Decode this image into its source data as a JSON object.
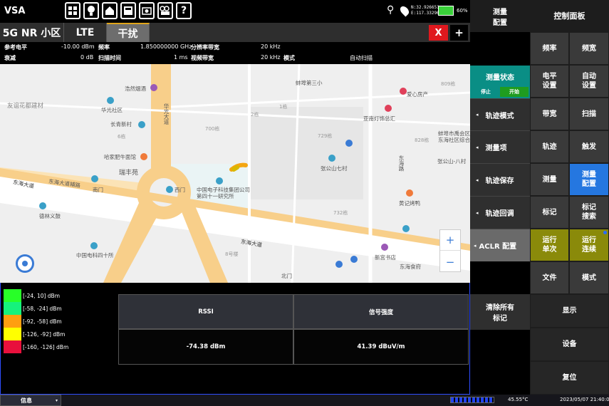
{
  "app_title": "VSA",
  "toolbar_icons": [
    "windows-icon",
    "bulb-icon",
    "home-icon",
    "save-icon",
    "camera-icon",
    "record-icon",
    "help-icon"
  ],
  "status_top": {
    "gps_lat": "N:32.926651",
    "gps_lon": "E:117.332960",
    "battery": "60%"
  },
  "tabs": [
    {
      "label": "5G NR 小区"
    },
    {
      "label": "LTE"
    },
    {
      "label": "干扰"
    }
  ],
  "tab_buttons": {
    "close": "X",
    "add": "+"
  },
  "params": {
    "ref_level_label": "参考电平",
    "ref_level_value": "-10.00 dBm",
    "atten_label": "衰减",
    "atten_value": "0 dB",
    "freq_label": "频率",
    "freq_value": "1.850000000 GHz",
    "sweep_label": "扫描时间",
    "sweep_value": "1 ms",
    "rbw_label": "分辨率带宽",
    "rbw_value": "20 kHz",
    "vbw_label": "视频带宽",
    "vbw_value": "20 kHz",
    "mode_label": "模式",
    "mode_value": "自动扫描"
  },
  "map": {
    "labels": [
      "浩然烟酒",
      "华光社区",
      "长青新村",
      "哈家肥牛面馆",
      "瑞丰苑",
      "友谊花都建材",
      "东海大道",
      "东海大道辅路",
      "南门",
      "西门",
      "华光大道",
      "中国电子科技集团公司第四十一研究所",
      "德林义鼓",
      "中国电科四十所",
      "北门",
      "新宫书店",
      "东海食府",
      "黄记烤鸭",
      "张公山七村",
      "亚南灯饰总汇",
      "爱心房产",
      "蚌埠市禹会区东海社区综合",
      "张公山-八村",
      "蚌埠第三小",
      "东海路"
    ],
    "buildings": [
      "6栋",
      "6栋",
      "700栋",
      "2栋",
      "1栋",
      "729栋",
      "828栋",
      "809栋",
      "732栋",
      "8号楼"
    ],
    "zoom_in": "+",
    "zoom_out": "−"
  },
  "legend": [
    {
      "range": "[-24, 10] dBm",
      "color": "#28ff28"
    },
    {
      "range": "[-58, -24] dBm",
      "color": "#16f27c"
    },
    {
      "range": "[-92, -58] dBm",
      "color": "#ff9f10"
    },
    {
      "range": "[-126, -92] dBm",
      "color": "#ffff00"
    },
    {
      "range": "[-160, -126] dBm",
      "color": "#e8103c"
    }
  ],
  "table": {
    "headers": [
      "RSSI",
      "信号强度"
    ],
    "values": [
      "-74.38 dBm",
      "41.39 dBuV/m"
    ]
  },
  "mid_panel": {
    "title_l1": "测量",
    "title_l2": "配置",
    "status_label": "测量状态",
    "stop": "停止",
    "start": "开始",
    "items": [
      "轨迹模式",
      "测量项",
      "轨迹保存",
      "轨迹回调",
      "ACLR 配置"
    ],
    "clear_l1": "清除所有",
    "clear_l2": "标记"
  },
  "right_panel": {
    "title": "控制面板",
    "buttons": [
      [
        "频率",
        "频宽"
      ],
      [
        "电平\n设置",
        "自动\n设置"
      ],
      [
        "带宽",
        "扫描"
      ],
      [
        "轨迹",
        "触发"
      ],
      [
        "测量",
        "测量\n配置"
      ],
      [
        "标记",
        "标记\n搜索"
      ],
      [
        "运行\n单次",
        "运行\n连续"
      ],
      [
        "文件",
        "模式"
      ]
    ],
    "display": "显示",
    "device": "设备",
    "reset": "复位"
  },
  "status_bar": {
    "info": "信息",
    "temp": "45.55°C",
    "datetime": "2023/05/07 21:40:05"
  },
  "colors": {
    "accent_blue": "#2577e0",
    "olive": "#8a8a0a",
    "status_teal": "#0a8e85"
  }
}
